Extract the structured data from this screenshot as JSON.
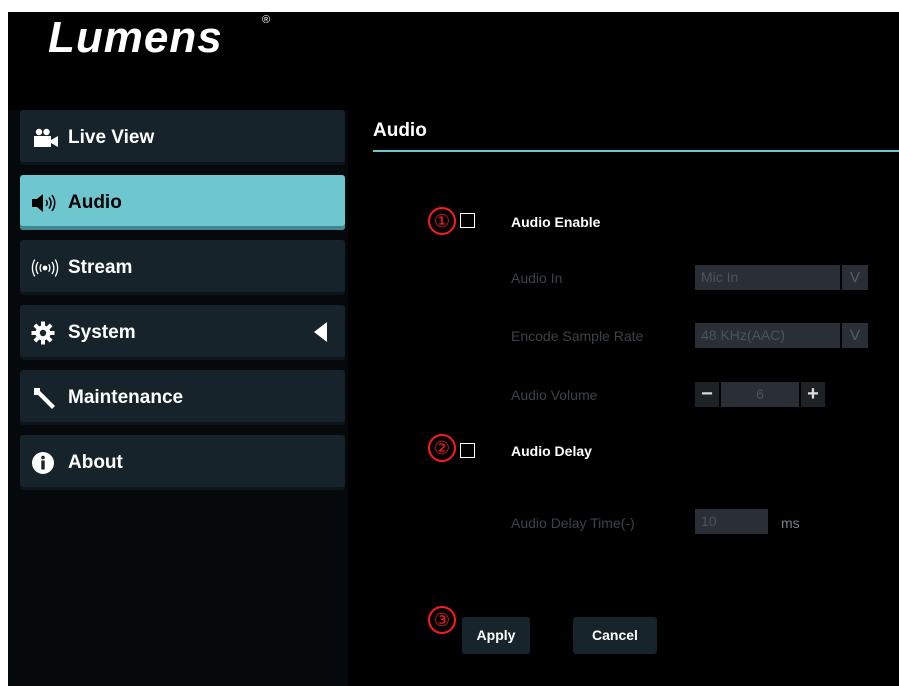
{
  "brand": {
    "logo_text": "Lumens",
    "registered_mark": "®"
  },
  "sidebar": {
    "items": [
      {
        "label": "Live View",
        "icon": "video-camera-icon",
        "active": false
      },
      {
        "label": "Audio",
        "icon": "speaker-icon",
        "active": true
      },
      {
        "label": "Stream",
        "icon": "broadcast-icon",
        "active": false
      },
      {
        "label": "System",
        "icon": "gear-icon",
        "active": false,
        "expand_arrow": "collapse-arrow-icon"
      },
      {
        "label": "Maintenance",
        "icon": "wrench-icon",
        "active": false
      },
      {
        "label": "About",
        "icon": "info-icon",
        "active": false
      }
    ]
  },
  "main": {
    "title": "Audio",
    "annotations": [
      "①",
      "②",
      "③"
    ],
    "audio_enable": {
      "label": "Audio Enable",
      "checked": false
    },
    "audio_in": {
      "label": "Audio In",
      "value": "Mic In"
    },
    "encode_sample_rate": {
      "label": "Encode Sample Rate",
      "value": "48 KHz(AAC)"
    },
    "audio_volume": {
      "label": "Audio Volume",
      "value": "6",
      "minus": "−",
      "plus": "+"
    },
    "audio_delay": {
      "label": "Audio Delay",
      "checked": false
    },
    "audio_delay_time": {
      "label": "Audio Delay Time(-)",
      "value": "10",
      "unit": "ms"
    },
    "select_arrow": "V",
    "apply_label": "Apply",
    "cancel_label": "Cancel"
  },
  "colors": {
    "accent": "#6ec7cf",
    "annotation": "#ff1a1a",
    "nav_bg": "#16232b",
    "disabled_text": "#3c4248"
  }
}
